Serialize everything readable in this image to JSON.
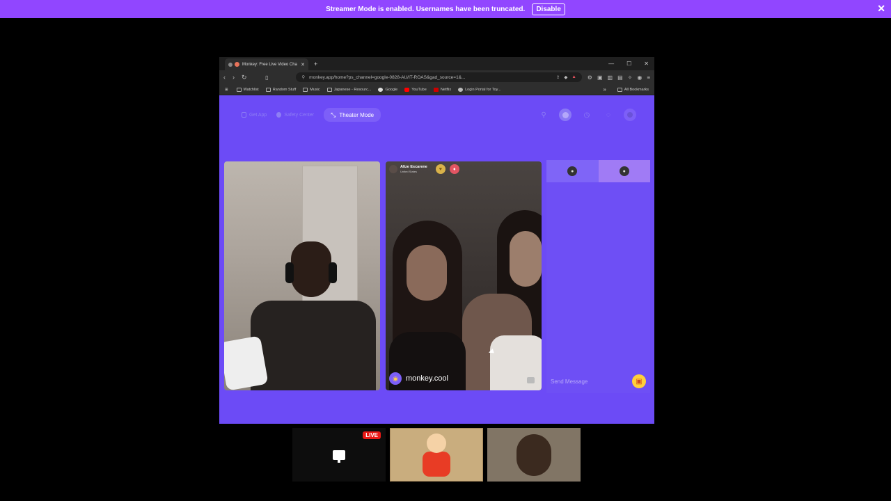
{
  "banner": {
    "message": "Streamer Mode is enabled. Usernames have been truncated.",
    "disable_label": "Disable",
    "close_glyph": "✕"
  },
  "browser": {
    "tab_title": "Monkey: Free Live Video Cha",
    "url": "monkey.app/home?ps_channel=google-0828-AU/IT-ROAS&gad_source=1&...",
    "bookmarks": [
      "Watchlist",
      "Random Stuff",
      "Music",
      "Japanese - Resourc...",
      "Google",
      "YouTube",
      "Netflix",
      "Login Portal for Toy..."
    ],
    "all_bookmarks_label": "All Bookmarks"
  },
  "site_nav": {
    "get_app_label": "Get App",
    "safety_center_label": "Safety Center",
    "theater_mode_label": "Theater Mode"
  },
  "partner": {
    "name": "Alize Escarene",
    "country": "United States"
  },
  "watermark": "monkey.cool",
  "chat": {
    "placeholder": "Send Message"
  },
  "stream": {
    "live_label": "LIVE"
  },
  "colors": {
    "banner": "#9146ff",
    "site_bg": "#6c4bf6",
    "live": "#e91916"
  }
}
